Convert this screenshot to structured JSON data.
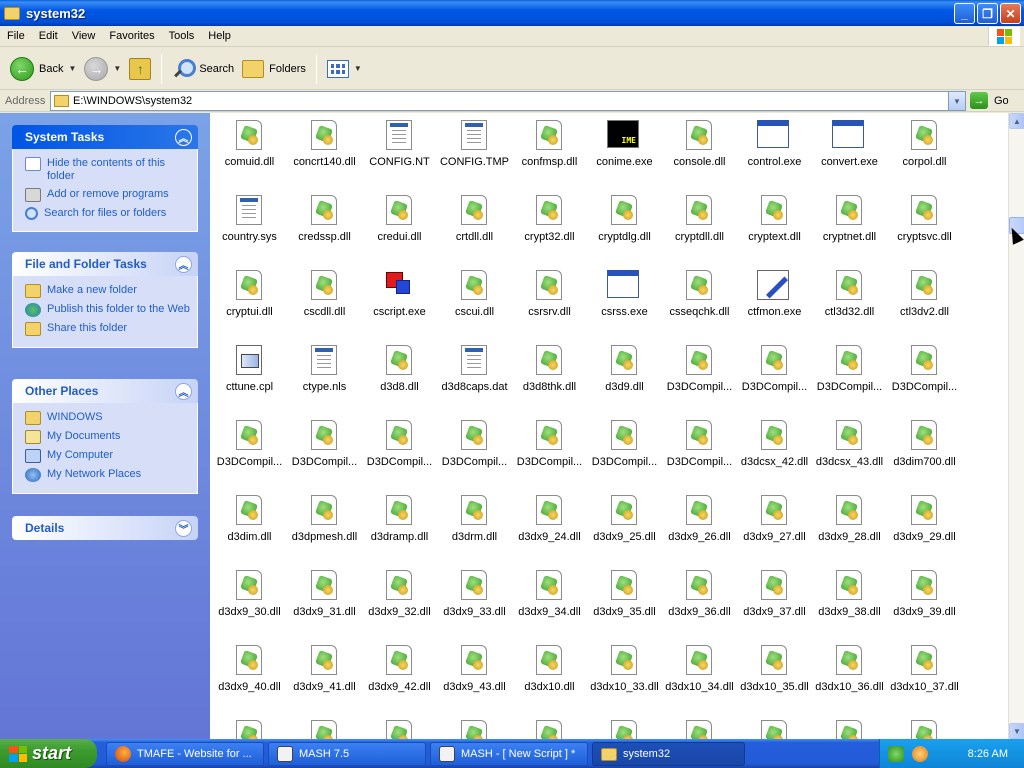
{
  "window": {
    "title": "system32",
    "controls": [
      "_",
      "❐",
      "✕"
    ]
  },
  "menu": [
    "File",
    "Edit",
    "View",
    "Favorites",
    "Tools",
    "Help"
  ],
  "toolbar": {
    "back_label": "Back",
    "search_label": "Search",
    "folders_label": "Folders"
  },
  "address": {
    "label": "Address",
    "path": "E:\\WINDOWS\\system32",
    "go_label": "Go"
  },
  "taskpane": {
    "system_tasks": {
      "title": "System Tasks",
      "items": [
        "Hide the contents of this folder",
        "Add or remove programs",
        "Search for files or folders"
      ]
    },
    "file_folder_tasks": {
      "title": "File and Folder Tasks",
      "items": [
        "Make a new folder",
        "Publish this folder to the Web",
        "Share this folder"
      ]
    },
    "other_places": {
      "title": "Other Places",
      "items": [
        "WINDOWS",
        "My Documents",
        "My Computer",
        "My Network Places"
      ]
    },
    "details": {
      "title": "Details"
    }
  },
  "files": [
    {
      "name": "comuid.dll",
      "icon": "dll"
    },
    {
      "name": "concrt140.dll",
      "icon": "dll"
    },
    {
      "name": "CONFIG.NT",
      "icon": "cfg"
    },
    {
      "name": "CONFIG.TMP",
      "icon": "cfg"
    },
    {
      "name": "confmsp.dll",
      "icon": "dll"
    },
    {
      "name": "conime.exe",
      "icon": "ime"
    },
    {
      "name": "console.dll",
      "icon": "dll"
    },
    {
      "name": "control.exe",
      "icon": "win"
    },
    {
      "name": "convert.exe",
      "icon": "win"
    },
    {
      "name": "corpol.dll",
      "icon": "dll"
    },
    {
      "name": "country.sys",
      "icon": "cfg"
    },
    {
      "name": "credssp.dll",
      "icon": "dll"
    },
    {
      "name": "credui.dll",
      "icon": "dll"
    },
    {
      "name": "crtdll.dll",
      "icon": "dll"
    },
    {
      "name": "crypt32.dll",
      "icon": "dll"
    },
    {
      "name": "cryptdlg.dll",
      "icon": "dll"
    },
    {
      "name": "cryptdll.dll",
      "icon": "dll"
    },
    {
      "name": "cryptext.dll",
      "icon": "dll"
    },
    {
      "name": "cryptnet.dll",
      "icon": "dll"
    },
    {
      "name": "cryptsvc.dll",
      "icon": "dll"
    },
    {
      "name": "cryptui.dll",
      "icon": "dll"
    },
    {
      "name": "cscdll.dll",
      "icon": "dll"
    },
    {
      "name": "cscript.exe",
      "icon": "script"
    },
    {
      "name": "cscui.dll",
      "icon": "dll"
    },
    {
      "name": "csrsrv.dll",
      "icon": "dll"
    },
    {
      "name": "csrss.exe",
      "icon": "win"
    },
    {
      "name": "csseqchk.dll",
      "icon": "dll"
    },
    {
      "name": "ctfmon.exe",
      "icon": "ctf"
    },
    {
      "name": "ctl3d32.dll",
      "icon": "dll"
    },
    {
      "name": "ctl3dv2.dll",
      "icon": "dll"
    },
    {
      "name": "cttune.cpl",
      "icon": "cpl"
    },
    {
      "name": "ctype.nls",
      "icon": "cfg"
    },
    {
      "name": "d3d8.dll",
      "icon": "dll"
    },
    {
      "name": "d3d8caps.dat",
      "icon": "cfg"
    },
    {
      "name": "d3d8thk.dll",
      "icon": "dll"
    },
    {
      "name": "d3d9.dll",
      "icon": "dll"
    },
    {
      "name": "D3DCompil...",
      "icon": "dll"
    },
    {
      "name": "D3DCompil...",
      "icon": "dll"
    },
    {
      "name": "D3DCompil...",
      "icon": "dll"
    },
    {
      "name": "D3DCompil...",
      "icon": "dll"
    },
    {
      "name": "D3DCompil...",
      "icon": "dll"
    },
    {
      "name": "D3DCompil...",
      "icon": "dll"
    },
    {
      "name": "D3DCompil...",
      "icon": "dll"
    },
    {
      "name": "D3DCompil...",
      "icon": "dll"
    },
    {
      "name": "D3DCompil...",
      "icon": "dll"
    },
    {
      "name": "D3DCompil...",
      "icon": "dll"
    },
    {
      "name": "D3DCompil...",
      "icon": "dll"
    },
    {
      "name": "d3dcsx_42.dll",
      "icon": "dll"
    },
    {
      "name": "d3dcsx_43.dll",
      "icon": "dll"
    },
    {
      "name": "d3dim700.dll",
      "icon": "dll"
    },
    {
      "name": "d3dim.dll",
      "icon": "dll"
    },
    {
      "name": "d3dpmesh.dll",
      "icon": "dll"
    },
    {
      "name": "d3dramp.dll",
      "icon": "dll"
    },
    {
      "name": "d3drm.dll",
      "icon": "dll"
    },
    {
      "name": "d3dx9_24.dll",
      "icon": "dll"
    },
    {
      "name": "d3dx9_25.dll",
      "icon": "dll"
    },
    {
      "name": "d3dx9_26.dll",
      "icon": "dll"
    },
    {
      "name": "d3dx9_27.dll",
      "icon": "dll"
    },
    {
      "name": "d3dx9_28.dll",
      "icon": "dll"
    },
    {
      "name": "d3dx9_29.dll",
      "icon": "dll"
    },
    {
      "name": "d3dx9_30.dll",
      "icon": "dll"
    },
    {
      "name": "d3dx9_31.dll",
      "icon": "dll"
    },
    {
      "name": "d3dx9_32.dll",
      "icon": "dll"
    },
    {
      "name": "d3dx9_33.dll",
      "icon": "dll"
    },
    {
      "name": "d3dx9_34.dll",
      "icon": "dll"
    },
    {
      "name": "d3dx9_35.dll",
      "icon": "dll"
    },
    {
      "name": "d3dx9_36.dll",
      "icon": "dll"
    },
    {
      "name": "d3dx9_37.dll",
      "icon": "dll"
    },
    {
      "name": "d3dx9_38.dll",
      "icon": "dll"
    },
    {
      "name": "d3dx9_39.dll",
      "icon": "dll"
    },
    {
      "name": "d3dx9_40.dll",
      "icon": "dll"
    },
    {
      "name": "d3dx9_41.dll",
      "icon": "dll"
    },
    {
      "name": "d3dx9_42.dll",
      "icon": "dll"
    },
    {
      "name": "d3dx9_43.dll",
      "icon": "dll"
    },
    {
      "name": "d3dx10.dll",
      "icon": "dll"
    },
    {
      "name": "d3dx10_33.dll",
      "icon": "dll"
    },
    {
      "name": "d3dx10_34.dll",
      "icon": "dll"
    },
    {
      "name": "d3dx10_35.dll",
      "icon": "dll"
    },
    {
      "name": "d3dx10_36.dll",
      "icon": "dll"
    },
    {
      "name": "d3dx10_37.dll",
      "icon": "dll"
    },
    {
      "name": "",
      "icon": "dll"
    },
    {
      "name": "",
      "icon": "dll"
    },
    {
      "name": "",
      "icon": "dll"
    },
    {
      "name": "",
      "icon": "dll"
    },
    {
      "name": "",
      "icon": "dll"
    },
    {
      "name": "",
      "icon": "dll"
    },
    {
      "name": "",
      "icon": "dll"
    },
    {
      "name": "",
      "icon": "dll"
    },
    {
      "name": "",
      "icon": "dll"
    },
    {
      "name": "",
      "icon": "dll"
    }
  ],
  "taskbar": {
    "start_label": "start",
    "buttons": [
      {
        "label": "TMAFE - Website for ...",
        "icon": "firefox-icon"
      },
      {
        "label": "MASH 7.5",
        "icon": "mash-icon"
      },
      {
        "label": "MASH - [ New Script ] *",
        "icon": "mash-icon"
      },
      {
        "label": "system32",
        "icon": "folder-icon"
      }
    ],
    "clock": "8:26 AM"
  },
  "colors": {
    "title_bar": "#0058e6",
    "taskpane": "#7ba2e7",
    "taskbar": "#245edb",
    "start_button": "#3c9b2e",
    "link_blue": "#215dc6"
  }
}
